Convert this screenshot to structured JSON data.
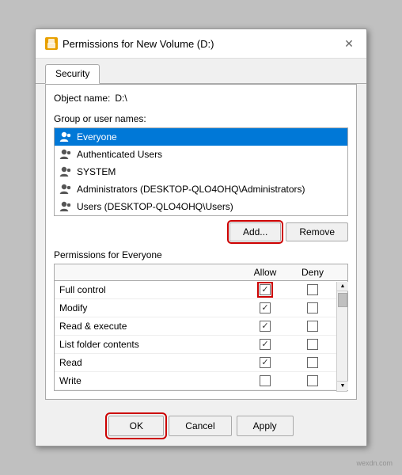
{
  "dialog": {
    "title": "Permissions for New Volume (D:)",
    "title_icon": "🔒",
    "close_label": "✕"
  },
  "tabs": [
    {
      "label": "Security",
      "active": true
    }
  ],
  "object_name_label": "Object name:",
  "object_name_value": "D:\\",
  "group_label": "Group or user names:",
  "users": [
    {
      "name": "Everyone",
      "selected": true
    },
    {
      "name": "Authenticated Users",
      "selected": false
    },
    {
      "name": "SYSTEM",
      "selected": false
    },
    {
      "name": "Administrators (DESKTOP-QLO4OHQ\\Administrators)",
      "selected": false
    },
    {
      "name": "Users (DESKTOP-QLO4OHQ\\Users)",
      "selected": false
    }
  ],
  "buttons": {
    "add": "Add...",
    "remove": "Remove"
  },
  "permissions_label": "Permissions for Everyone",
  "permissions_headers": {
    "allow": "Allow",
    "deny": "Deny"
  },
  "permissions": [
    {
      "name": "Full control",
      "allow": true,
      "deny": false,
      "allow_highlighted": true
    },
    {
      "name": "Modify",
      "allow": true,
      "deny": false,
      "allow_highlighted": false
    },
    {
      "name": "Read & execute",
      "allow": true,
      "deny": false,
      "allow_highlighted": false
    },
    {
      "name": "List folder contents",
      "allow": true,
      "deny": false,
      "allow_highlighted": false
    },
    {
      "name": "Read",
      "allow": true,
      "deny": false,
      "allow_highlighted": false
    },
    {
      "name": "Write",
      "allow": false,
      "deny": false,
      "allow_highlighted": false
    }
  ],
  "dialog_buttons": {
    "ok": "OK",
    "cancel": "Cancel",
    "apply": "Apply"
  },
  "watermark": "wexdn.com"
}
